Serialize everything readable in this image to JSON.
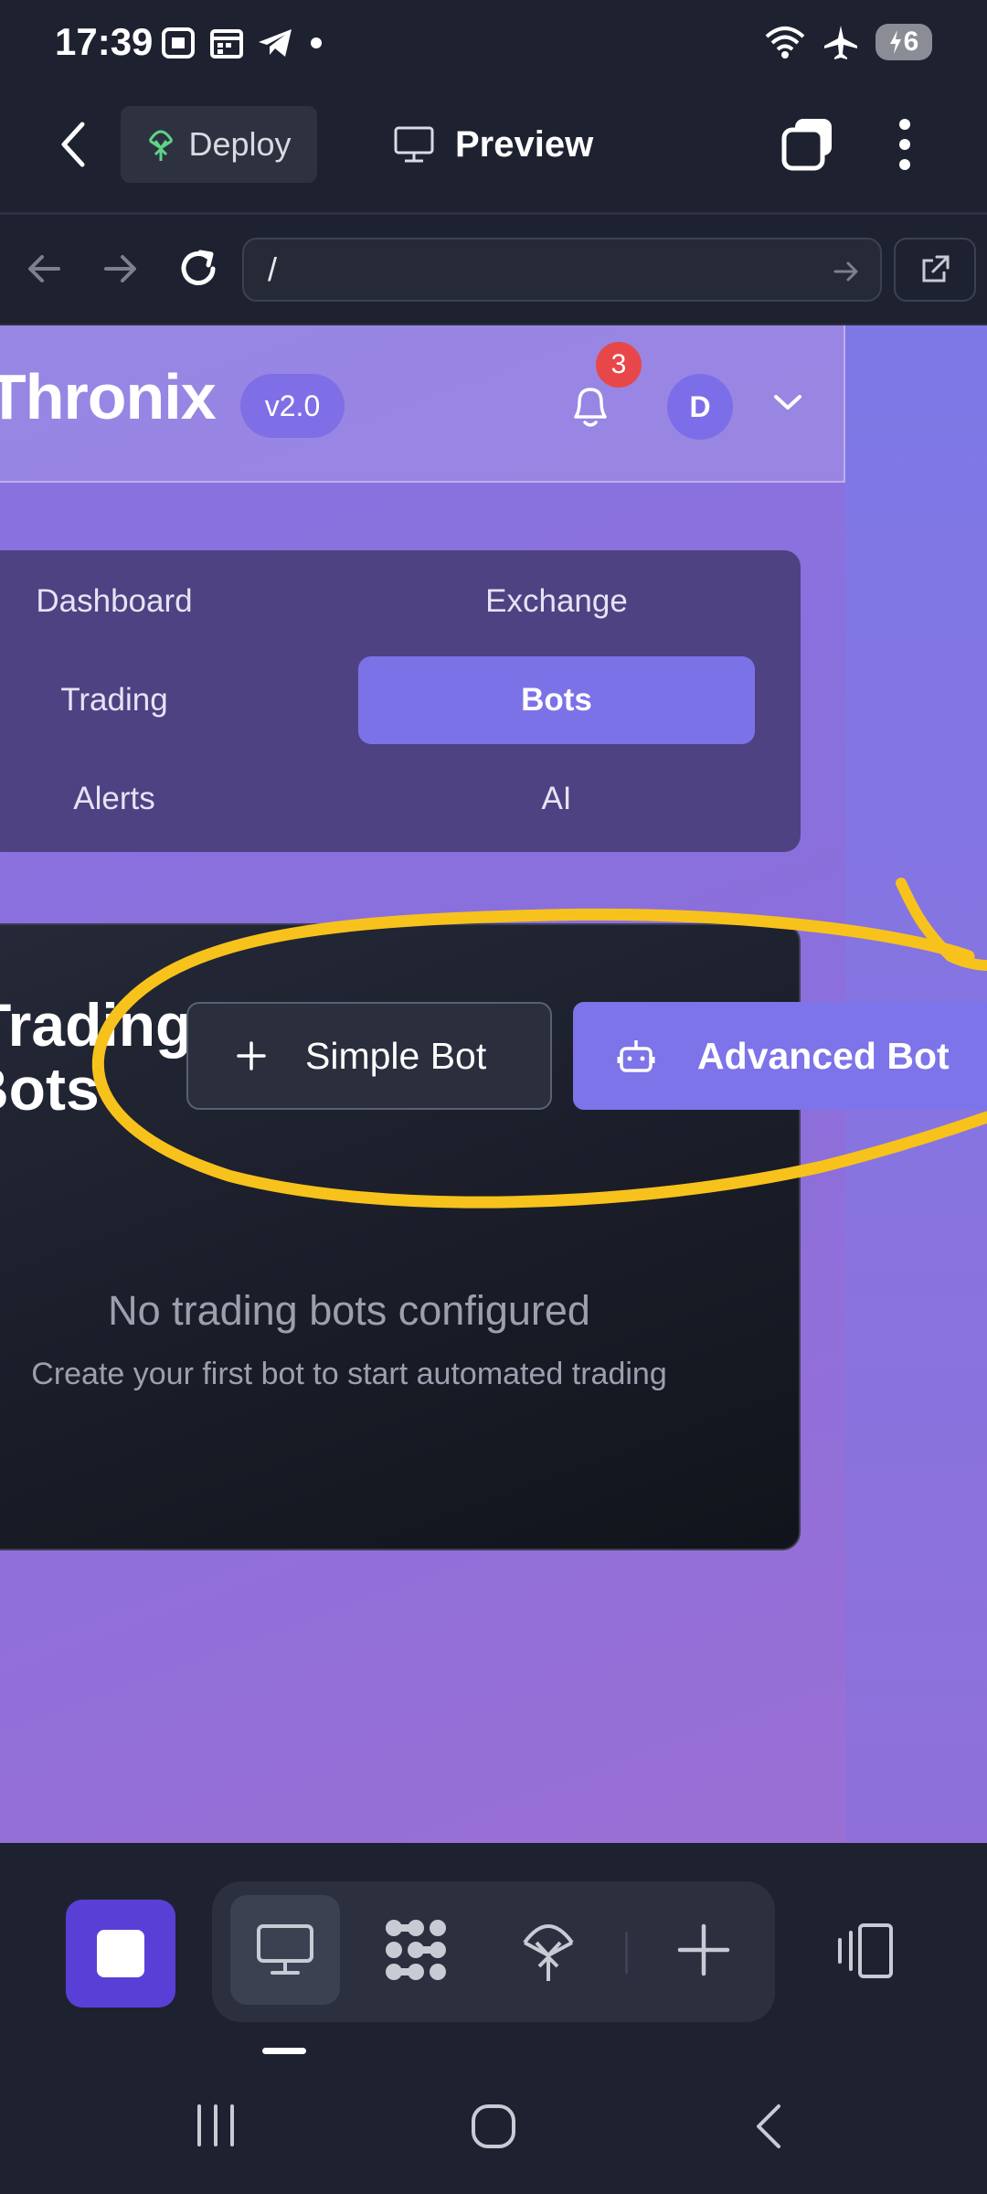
{
  "status_bar": {
    "time": "17:39",
    "battery": "6"
  },
  "app_bar": {
    "deploy_label": "Deploy",
    "preview_label": "Preview"
  },
  "url_bar": {
    "url": "/"
  },
  "site": {
    "brand": "Thronix",
    "version": "v2.0",
    "notifications": "3",
    "avatar_initial": "D"
  },
  "nav": {
    "items": [
      {
        "label": "Dashboard",
        "active": false
      },
      {
        "label": "Exchange",
        "active": false
      },
      {
        "label": "Trading",
        "active": false
      },
      {
        "label": "Bots",
        "active": true
      },
      {
        "label": "Alerts",
        "active": false
      },
      {
        "label": "AI",
        "active": false
      }
    ]
  },
  "bots": {
    "title_line1": "Trading",
    "title_line2": "Bots",
    "simple_bot_label": "Simple Bot",
    "advanced_bot_label": "Advanced Bot",
    "empty_title": "No trading bots configured",
    "empty_subtitle": "Create your first bot to start automated trading"
  },
  "colors": {
    "accent": "#7c74e8",
    "stop_button": "#5a3fd6",
    "annotation": "#f8c21c",
    "badge": "#e8474a"
  }
}
